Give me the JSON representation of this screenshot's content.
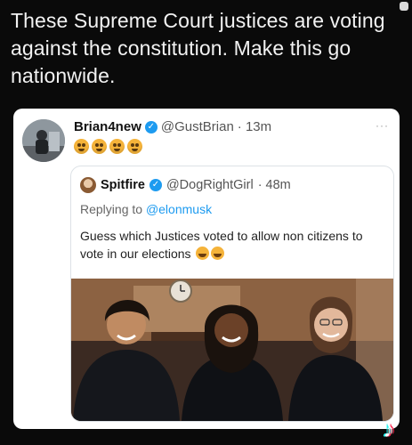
{
  "caption": "These Supreme Court justices are voting against the constitution. Make this go nationwide.",
  "post": {
    "display_name": "Brian4new",
    "handle": "@GustBrian",
    "time": "· 13m",
    "menu": "···",
    "reactions": [
      "angry-face-icon",
      "angry-face-icon",
      "angry-face-icon",
      "angry-face-icon"
    ]
  },
  "quoted_post": {
    "display_name": "Spitfire",
    "handle": "@DogRightGirl",
    "time": "· 48m",
    "replying_prefix": "Replying to ",
    "replying_to": "@elonmusk",
    "text": "Guess which Justices voted to allow non citizens to vote in our elections"
  },
  "colors": {
    "verified": "#1d9bf0",
    "background": "#0a0a0a",
    "card": "#ffffff"
  },
  "watermark": "tiktok-logo"
}
